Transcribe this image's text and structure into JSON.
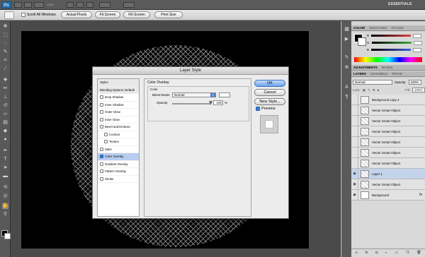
{
  "app": {
    "logo": "Ps",
    "zoom": "100%",
    "workspace": "ESSENTIALS"
  },
  "options": {
    "scroll_all_label": "Scroll All Windows",
    "buttons": [
      "Actual Pixels",
      "Fit Screen",
      "Fill Screen",
      "Print Size"
    ]
  },
  "tools": [
    "move-tool-icon",
    "marquee-tool-icon",
    "lasso-tool-icon",
    "quick-select-tool-icon",
    "crop-tool-icon",
    "eyedropper-tool-icon",
    "healing-tool-icon",
    "brush-tool-icon",
    "clone-stamp-tool-icon",
    "history-brush-tool-icon",
    "eraser-tool-icon",
    "gradient-tool-icon",
    "blur-tool-icon",
    "dodge-tool-icon",
    "pen-tool-icon",
    "type-tool-icon",
    "path-select-tool-icon",
    "shape-tool-icon",
    "3d-rotate-tool-icon",
    "3d-orbit-tool-icon",
    "hand-tool-icon",
    "zoom-tool-icon"
  ],
  "color_panel": {
    "tabs": [
      "COLOR",
      "SWATCHES",
      "STYLES"
    ],
    "channels": [
      {
        "label": "R",
        "value": "",
        "color": "#e04040"
      },
      {
        "label": "G",
        "value": "",
        "color": "#40b040"
      },
      {
        "label": "B",
        "value": "",
        "color": "#4060e0"
      }
    ]
  },
  "adjustments": {
    "tabs": [
      "ADJUSTMENTS",
      "MASKS"
    ]
  },
  "layers_panel": {
    "tabs": [
      "LAYERS",
      "CHANNELS",
      "PATHS"
    ],
    "blend_mode": "Normal",
    "opacity_label": "Opacity:",
    "opacity_value": "100%",
    "lock_label": "Lock:",
    "fill_label": "Fill:",
    "fill_value": "100%",
    "layers": [
      {
        "name": "Background copy 2",
        "visible": false,
        "selected": false,
        "fx": false
      },
      {
        "name": "Vector Smart Object",
        "visible": false,
        "selected": false,
        "fx": false
      },
      {
        "name": "Vector Smart Object",
        "visible": false,
        "selected": false,
        "fx": false
      },
      {
        "name": "Vector Smart Object",
        "visible": false,
        "selected": false,
        "fx": false
      },
      {
        "name": "Vector Smart Object",
        "visible": false,
        "selected": false,
        "fx": false
      },
      {
        "name": "Vector Smart Object",
        "visible": false,
        "selected": false,
        "fx": false
      },
      {
        "name": "Vector Smart Object",
        "visible": false,
        "selected": false,
        "fx": false
      },
      {
        "name": "Layer 1",
        "visible": true,
        "selected": true,
        "fx": false
      },
      {
        "name": "Vector Smart Object",
        "visible": true,
        "selected": false,
        "fx": false
      },
      {
        "name": "Background",
        "visible": true,
        "selected": false,
        "fx": true
      }
    ]
  },
  "dialog": {
    "title": "Layer Style",
    "styles": [
      {
        "label": "Styles",
        "type": "header"
      },
      {
        "label": "Blending Options: Default",
        "type": "header"
      },
      {
        "label": "Drop Shadow",
        "checked": false
      },
      {
        "label": "Inner Shadow",
        "checked": false
      },
      {
        "label": "Outer Glow",
        "checked": false
      },
      {
        "label": "Inner Glow",
        "checked": false
      },
      {
        "label": "Bevel and Emboss",
        "checked": false
      },
      {
        "label": "Contour",
        "checked": false,
        "indent": true
      },
      {
        "label": "Texture",
        "checked": false,
        "indent": true
      },
      {
        "label": "Satin",
        "checked": false
      },
      {
        "label": "Color Overlay",
        "checked": true,
        "selected": true
      },
      {
        "label": "Gradient Overlay",
        "checked": false
      },
      {
        "label": "Pattern Overlay",
        "checked": false
      },
      {
        "label": "Stroke",
        "checked": false
      }
    ],
    "color_overlay": {
      "group_title": "Color Overlay",
      "sub_title": "Color",
      "blend_mode_label": "Blend Mode:",
      "blend_mode_value": "Normal",
      "opacity_label": "Opacity:",
      "opacity_value": "100",
      "opacity_unit": "%",
      "color": "#ffffff"
    },
    "buttons": {
      "ok": "OK",
      "cancel": "Cancel",
      "new_style": "New Style..."
    },
    "preview_label": "Preview",
    "preview_checked": true
  }
}
